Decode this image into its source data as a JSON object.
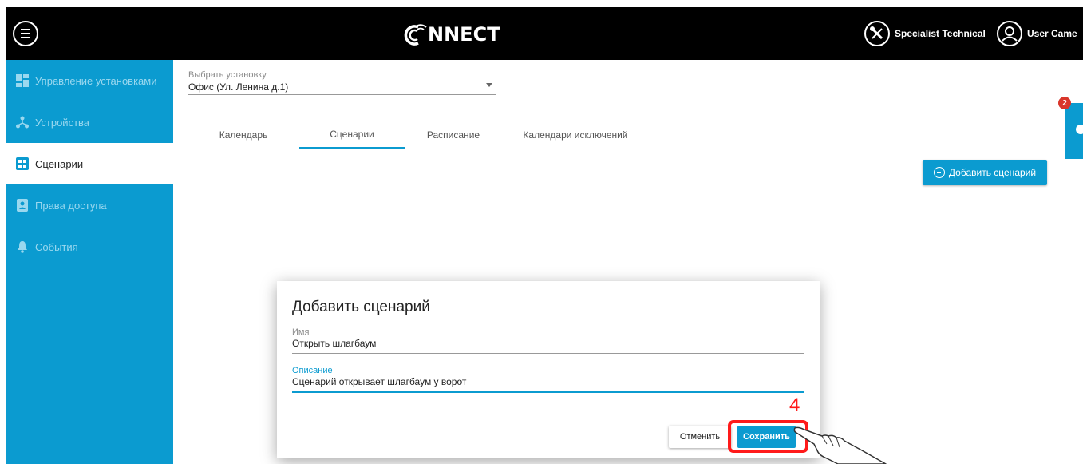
{
  "header": {
    "logo_text": "NNECT",
    "specialist_label": "Specialist Technical",
    "user_label": "User Came"
  },
  "sidebar": {
    "items": [
      {
        "label": "Управление установками",
        "icon": "dashboard-icon",
        "active": false
      },
      {
        "label": "Устройства",
        "icon": "devices-icon",
        "active": false
      },
      {
        "label": "Сценарии",
        "icon": "scenarios-icon",
        "active": true
      },
      {
        "label": "Права доступа",
        "icon": "access-rights-icon",
        "active": false
      },
      {
        "label": "События",
        "icon": "bell-icon",
        "active": false
      }
    ]
  },
  "installation_select": {
    "label": "Выбрать установку",
    "value": "Офис (Ул. Ленина д.1)"
  },
  "tabs": [
    {
      "label": "Календарь",
      "active": false
    },
    {
      "label": "Сценарии",
      "active": true
    },
    {
      "label": "Расписание",
      "active": false
    },
    {
      "label": "Календари исключений",
      "active": false
    }
  ],
  "add_scenario_button": "Добавить сценарий",
  "notifications": {
    "count": "2"
  },
  "dialog": {
    "title": "Добавить сценарий",
    "name_label": "Имя",
    "name_value": "Открыть шлагбаум",
    "description_label": "Описание",
    "description_value": "Сценарий открывает шлагбаум у ворот",
    "cancel_label": "Отменить",
    "save_label": "Сохранить"
  },
  "annotation": {
    "step_number": "4"
  },
  "colors": {
    "accent": "#0b9bd0",
    "header": "#000000",
    "highlight": "#ff1a1a",
    "badge": "#d9362b"
  }
}
